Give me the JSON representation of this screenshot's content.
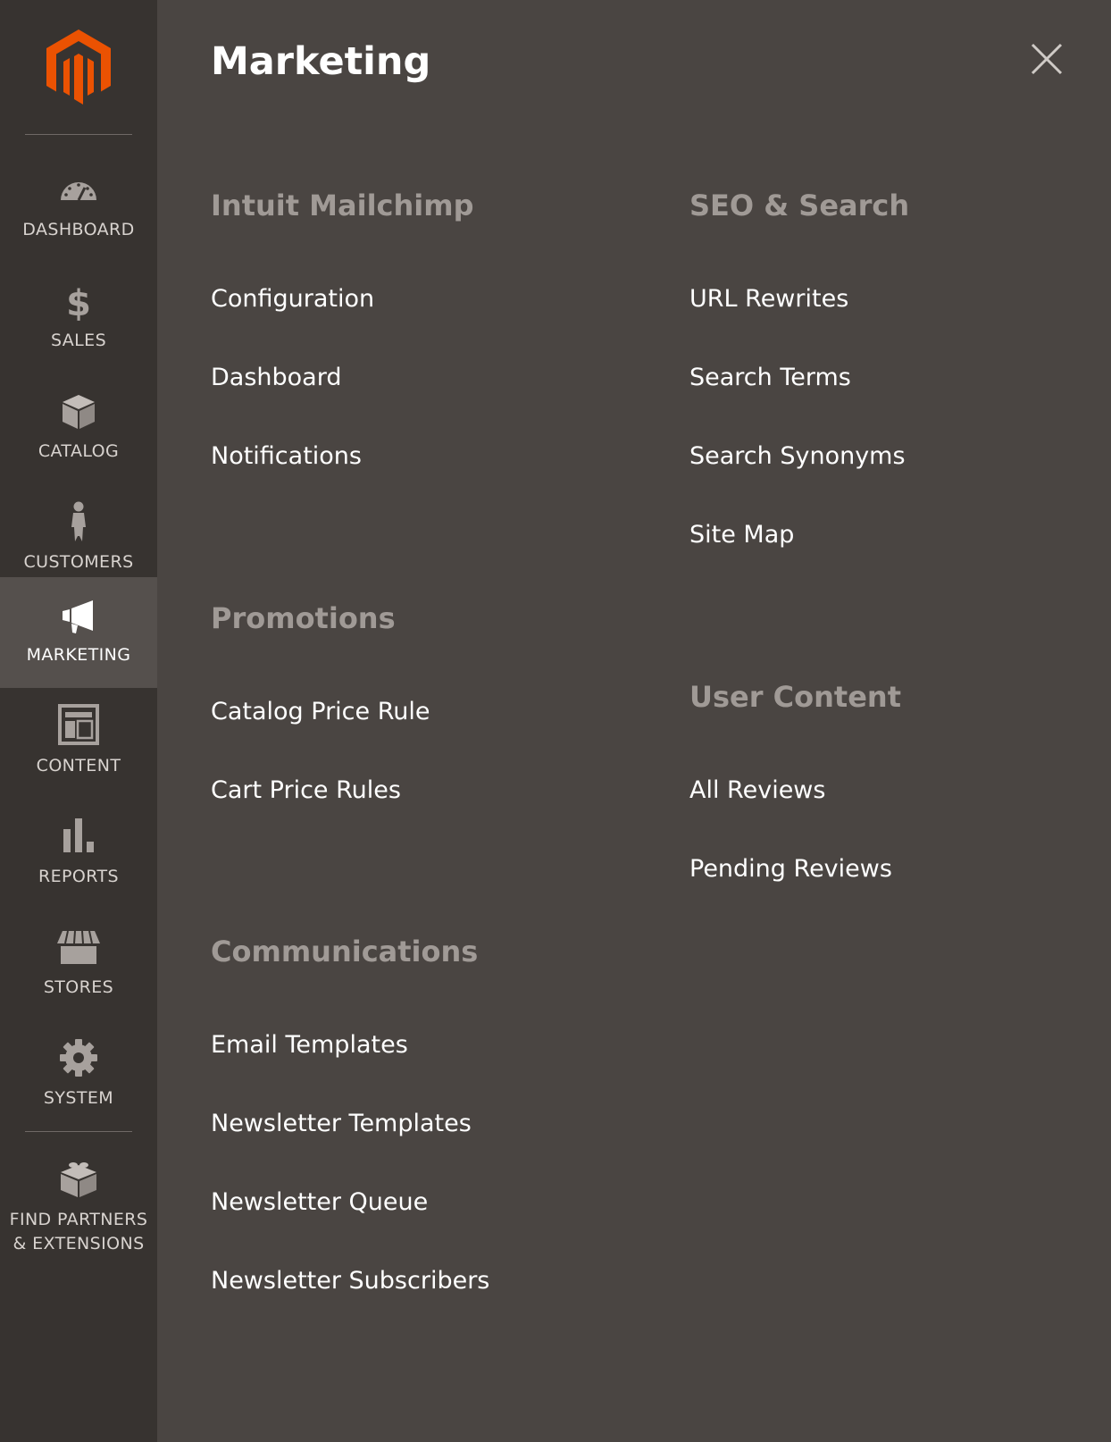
{
  "sidebar": {
    "logo": "magento-logo",
    "items": [
      {
        "label": "DASHBOARD",
        "icon": "dashboard-gauge-icon"
      },
      {
        "label": "SALES",
        "icon": "dollar-icon"
      },
      {
        "label": "CATALOG",
        "icon": "box-icon"
      },
      {
        "label": "CUSTOMERS",
        "icon": "person-icon"
      },
      {
        "label": "MARKETING",
        "icon": "megaphone-icon",
        "active": true
      },
      {
        "label": "CONTENT",
        "icon": "layout-icon"
      },
      {
        "label": "REPORTS",
        "icon": "bar-chart-icon"
      },
      {
        "label": "STORES",
        "icon": "storefront-icon"
      },
      {
        "label": "SYSTEM",
        "icon": "gear-icon"
      }
    ],
    "extensions": {
      "line1": "FIND PARTNERS",
      "line2": "& EXTENSIONS",
      "icon": "lego-block-icon"
    }
  },
  "panel": {
    "title": "Marketing",
    "close_icon": "close-icon",
    "sections": {
      "mailchimp": {
        "title": "Intuit Mailchimp",
        "items": [
          "Configuration",
          "Dashboard",
          "Notifications"
        ]
      },
      "promotions": {
        "title": "Promotions",
        "items": [
          "Catalog Price Rule",
          "Cart Price Rules"
        ]
      },
      "communications": {
        "title": "Communications",
        "items": [
          "Email Templates",
          "Newsletter Templates",
          "Newsletter Queue",
          "Newsletter Subscribers"
        ]
      },
      "seo": {
        "title": "SEO & Search",
        "items": [
          "URL Rewrites",
          "Search Terms",
          "Search Synonyms",
          "Site Map"
        ]
      },
      "user_content": {
        "title": "User Content",
        "items": [
          "All Reviews",
          "Pending Reviews"
        ]
      }
    }
  },
  "colors": {
    "panel_bg": "#4a4542",
    "sidebar_bg": "#373330",
    "active_bg": "#55504d",
    "brand_orange": "#eb5202",
    "section_title": "#a09a96"
  }
}
